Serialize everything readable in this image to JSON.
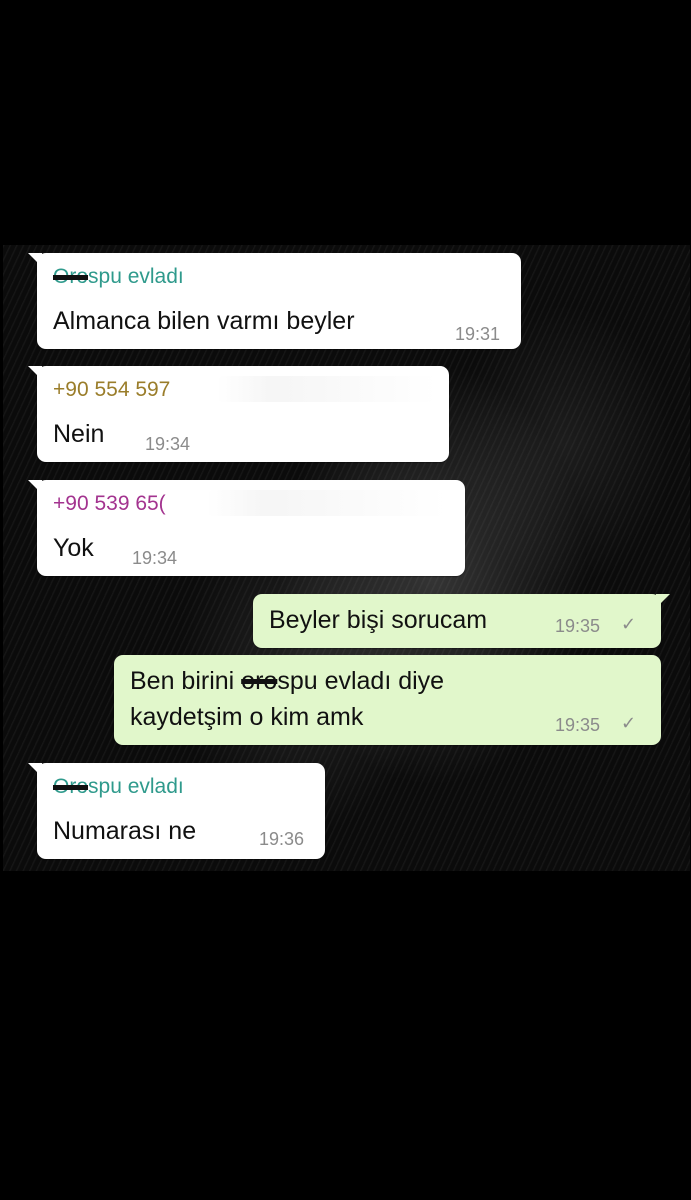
{
  "colors": {
    "incoming_bubble": "#ffffff",
    "outgoing_bubble": "#e1f7cb",
    "sender_teal": "#2f9a8c",
    "sender_olive": "#9a7d2a",
    "sender_purple": "#a3338f",
    "timestamp": "#8b8b8b"
  },
  "messages": [
    {
      "direction": "incoming",
      "sender_struck": "Oro",
      "sender_rest": "spu evladı",
      "text": "Almanca bilen varmı beyler",
      "time": "19:31"
    },
    {
      "direction": "incoming",
      "sender": "+90 554 597",
      "text": "Nein",
      "time": "19:34"
    },
    {
      "direction": "incoming",
      "sender": "+90 539 65(",
      "text": "Yok",
      "time": "19:34"
    },
    {
      "direction": "outgoing",
      "text": "Beyler bişi sorucam",
      "time": "19:35",
      "status_icon": "check-icon"
    },
    {
      "direction": "outgoing",
      "line1_pre": "Ben birini ",
      "line1_struck": "oro",
      "line1_post": "spu evladı diye",
      "line2": "kaydetşim o kim amk",
      "time": "19:35",
      "status_icon": "check-icon"
    },
    {
      "direction": "incoming",
      "sender_struck": "Oro",
      "sender_rest": "spu evladı",
      "text": "Numarası ne",
      "time": "19:36"
    }
  ]
}
